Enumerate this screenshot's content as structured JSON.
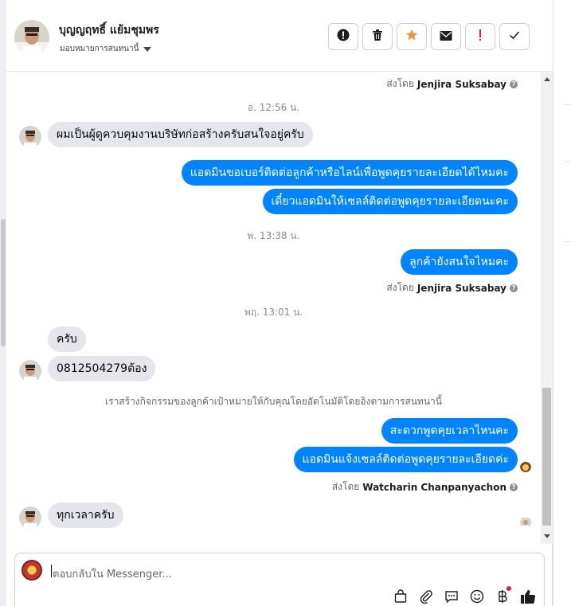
{
  "header": {
    "name": "บุญญฤทธิ์ แย้มชุมพร",
    "assign_label": "มอบหมายการสนทนานี้"
  },
  "toolbar": {
    "buttons": [
      {
        "icon": "alert-circle-icon",
        "color": "#1c1e21"
      },
      {
        "icon": "trash-icon",
        "color": "#1c1e21"
      },
      {
        "icon": "star-icon",
        "color": "#f7923b"
      },
      {
        "icon": "envelope-icon",
        "color": "#1c1e21"
      },
      {
        "icon": "exclamation-icon",
        "color": "#e41e3f"
      },
      {
        "icon": "check-icon",
        "color": "#1c1e21"
      }
    ]
  },
  "thread": {
    "sent_by_1": {
      "prefix": "ส่งโดย",
      "agent": "Jenjira Suksabay"
    },
    "ts_1": "อ. 12:56 น.",
    "msg_1": "ผมเป็นผู้ดูควบคุมงานบริษัทก่อสร้างครับสนใจอยู่ครับ",
    "msg_2": "แอดมินขอเบอร์ติดต่อลูกค้าหรือไลน์เพื่อพูดคุยรายละเอียดได้ไหมคะ",
    "msg_3": "เดี๋ยวแอดมินให้เซลล์ติดต่อพูดคุยรายละเอียดนะคะ",
    "ts_2": "พ. 13:38 น.",
    "msg_4": "ลูกค้ายังสนใจไหมคะ",
    "sent_by_2": {
      "prefix": "ส่งโดย",
      "agent": "Jenjira Suksabay"
    },
    "ts_3": "พฤ. 13:01 น.",
    "msg_5": "ครับ",
    "msg_6": "0812504279ต้อง",
    "system_note": "เราสร้างกิจกรรมของลูกค้าเป้าหมายให้กับคุณโดยอัตโนมัติโดยอิงตามการสนทนานี้",
    "msg_7": "สะดวกพูดคุยเวลาไหนคะ",
    "msg_8": "แอดมินแจ้งเซลล์ติดต่อพูดคุยรายละเอียดค่ะ",
    "sent_by_3": {
      "prefix": "ส่งโดย",
      "agent": "Watcharin Chanpanyachon"
    },
    "msg_9": "ทุกเวลาครับ"
  },
  "composer": {
    "placeholder": "ตอบกลับใน Messenger..."
  },
  "colors": {
    "outgoing": "#0084ff",
    "incoming": "#e4e6eb"
  }
}
